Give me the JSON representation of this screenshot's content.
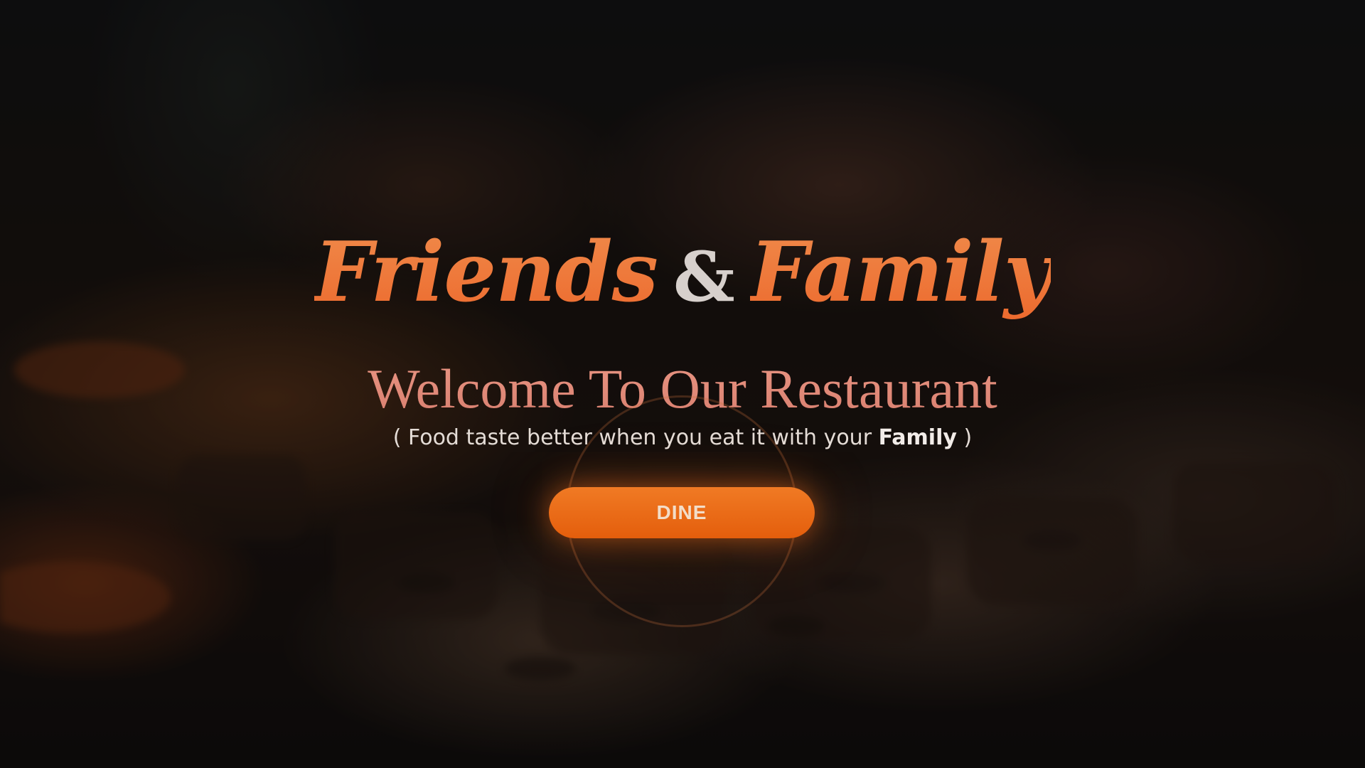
{
  "hero": {
    "brand": {
      "word1": "Friends",
      "amp": "&",
      "word2": "Family"
    },
    "welcome": "Welcome To Our Restaurant",
    "tagline": {
      "open": "( Food taste better when you eat it with your ",
      "strong": "Family",
      "close": " )"
    },
    "cta_label": "DINE"
  },
  "colors": {
    "accent_orange": "#f0703a",
    "welcome_pink": "#e0907c",
    "button_orange": "#e86a14",
    "text_light": "#e4dcd6"
  },
  "icons": {
    "background": "grilled-food-photo"
  }
}
